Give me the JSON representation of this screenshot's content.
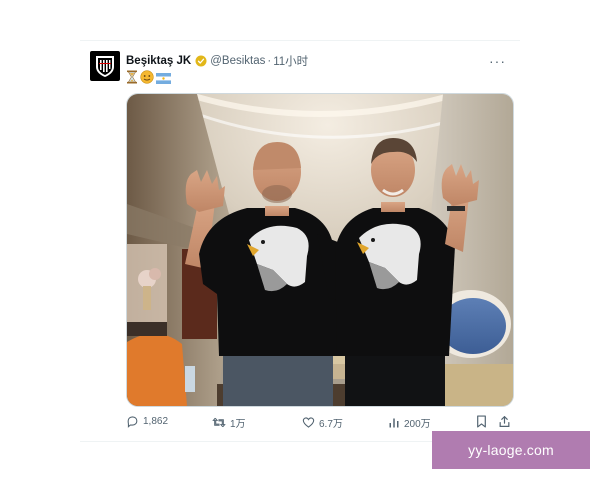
{
  "tweet": {
    "display_name": "Beşiktaş JK",
    "handle": "@Besiktas",
    "separator": "·",
    "time": "11小时",
    "emojis": [
      "hourglass-icon",
      "face-icon",
      "flag-argentina-icon"
    ],
    "more_label": "···",
    "verified_color": "#e2b719"
  },
  "actions": {
    "reply_count": "1,862",
    "retweet_count": "1万",
    "like_count": "6.7万",
    "views_count": "200万"
  },
  "watermark": "yy-laoge.com"
}
